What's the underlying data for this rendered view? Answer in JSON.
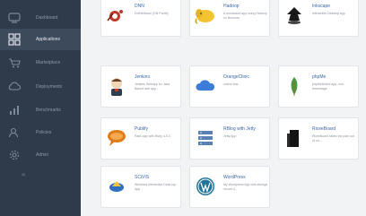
{
  "sidebar": {
    "items": [
      {
        "label": "Dashboard",
        "icon": "dashboard-icon"
      },
      {
        "label": "Applications",
        "icon": "applications-icon"
      },
      {
        "label": "Marketplace",
        "icon": "marketplace-icon"
      },
      {
        "label": "Deployments",
        "icon": "deployments-icon"
      },
      {
        "label": "Benchmarks",
        "icon": "benchmarks-icon"
      },
      {
        "label": "Policies",
        "icon": "policies-icon"
      },
      {
        "label": "Admin",
        "icon": "admin-icon"
      }
    ],
    "active_index": 1,
    "collapse_glyph": "«"
  },
  "apps": [
    {
      "title": "DNN",
      "desc": "DotNetNuke (DN Portal)",
      "logo": "dnn-logo-icon"
    },
    {
      "title": "Hadoop",
      "desc": "A wordcount app using Hadoop on Bochum",
      "logo": "hadoop-elephant-icon"
    },
    {
      "title": "Inkscape",
      "desc": "Interactive Desktop App",
      "logo": "inkscape-icon"
    },
    {
      "title": "Jenkins",
      "desc": "Jenkins Webapp for Java Based web app...",
      "logo": "jenkins-butler-icon"
    },
    {
      "title": "OrangeClinic",
      "desc": "orders test",
      "logo": "cloud-icon"
    },
    {
      "title": "phpMe",
      "desc": "phpMeSelect app, non-threestage",
      "logo": "mongodb-leaf-icon"
    },
    {
      "title": "Publify",
      "desc": "Rails app with Ruby 4.0.3",
      "logo": "speech-bubble-icon"
    },
    {
      "title": "RBlog with Jetty",
      "desc": "Jetty App",
      "logo": "server-rack-icon"
    },
    {
      "title": "RiceeBoard",
      "desc": "RiceeBoard takes the pain out of on...",
      "logo": "black-tower-icon"
    },
    {
      "title": "SCiVIS",
      "desc": "Windows Interactive Desk top App",
      "logo": "scivis-icon"
    },
    {
      "title": "WordPress",
      "desc": "My Wordpress App with storage mount 4...",
      "logo": "wordpress-icon"
    }
  ],
  "colors": {
    "sidebar_bg": "#2f3b4a",
    "sidebar_active": "#3d4a5c",
    "link": "#3b66a8"
  }
}
